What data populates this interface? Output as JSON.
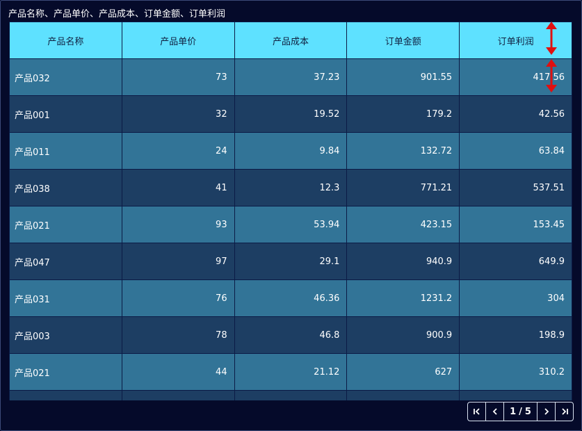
{
  "title": "产品名称、产品单价、产品成本、订单金额、订单利润",
  "columns": [
    "产品名称",
    "产品单价",
    "产品成本",
    "订单金额",
    "订单利润"
  ],
  "rows": [
    [
      "产品032",
      "73",
      "37.23",
      "901.55",
      "417.56"
    ],
    [
      "产品001",
      "32",
      "19.52",
      "179.2",
      "42.56"
    ],
    [
      "产品011",
      "24",
      "9.84",
      "132.72",
      "63.84"
    ],
    [
      "产品038",
      "41",
      "12.3",
      "771.21",
      "537.51"
    ],
    [
      "产品021",
      "93",
      "53.94",
      "423.15",
      "153.45"
    ],
    [
      "产品047",
      "97",
      "29.1",
      "940.9",
      "649.9"
    ],
    [
      "产品031",
      "76",
      "46.36",
      "1231.2",
      "304"
    ],
    [
      "产品003",
      "78",
      "46.8",
      "900.9",
      "198.9"
    ],
    [
      "产品021",
      "44",
      "21.12",
      "627",
      "310.2"
    ],
    [
      "",
      "",
      "",
      "",
      ""
    ]
  ],
  "pager": {
    "first_icon": "first-page-icon",
    "prev_icon": "prev-page-icon",
    "current": "1",
    "separator": "/",
    "total": "5",
    "next_icon": "next-page-icon",
    "last_icon": "last-page-icon"
  },
  "colors": {
    "background": "#050a2a",
    "header": "#5ee1ff",
    "row_odd": "#327497",
    "row_even": "#1d3e63",
    "annotation_arrow": "#e01010"
  }
}
